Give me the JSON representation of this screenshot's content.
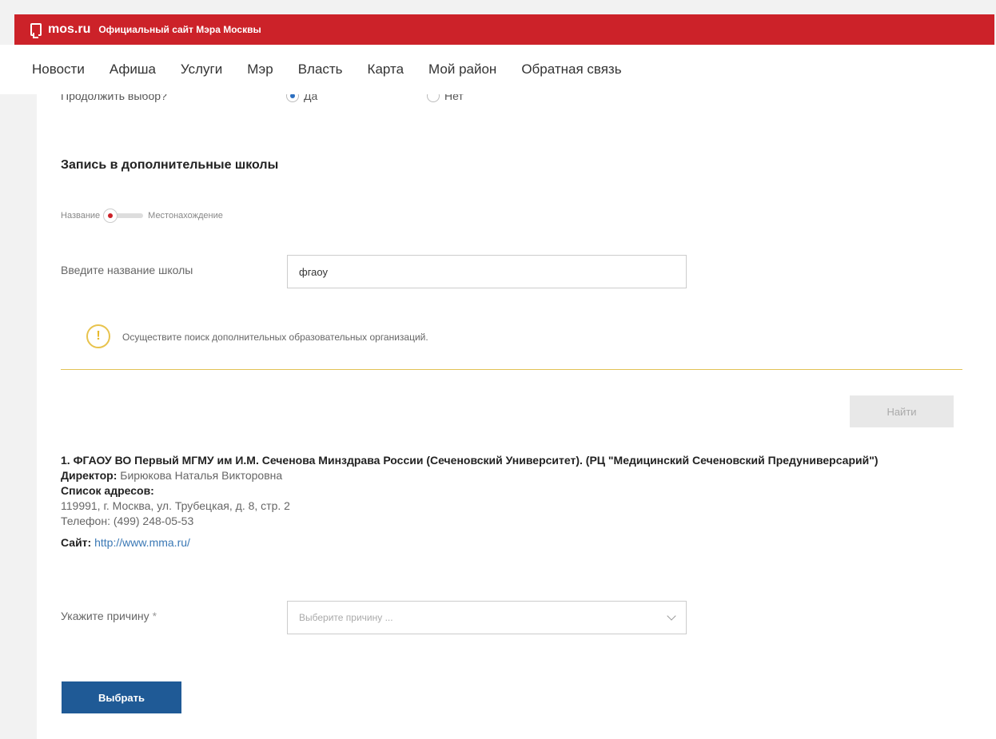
{
  "header": {
    "logo_text": "mos.ru",
    "slogan": "Официальный сайт Мэра Москвы"
  },
  "nav": {
    "items": [
      "Новости",
      "Афиша",
      "Услуги",
      "Мэр",
      "Власть",
      "Карта",
      "Мой район",
      "Обратная связь"
    ]
  },
  "continue_choice": {
    "question": "Продолжить выбор?",
    "yes": "Да",
    "no": "Нет",
    "selected": "Да"
  },
  "section": {
    "title": "Запись в дополнительные школы"
  },
  "search_mode": {
    "option_left": "Название",
    "option_right": "Местонахождение",
    "selected": "Название"
  },
  "school_search": {
    "label": "Введите название школы",
    "value": "фгаоу"
  },
  "notice": {
    "text": "Осуществите поиск дополнительных образовательных организаций."
  },
  "find_button": {
    "label": "Найти"
  },
  "result": {
    "name": "1. ФГАОУ ВО Первый МГМУ им И.М. Сеченова Минздрава России (Сеченовский Университет). (РЦ \"Медицинский Сеченовский Предуниверсарий\")",
    "director_label": "Директор:",
    "director": "Бирюкова Наталья Викторовна",
    "addresses_label": "Список адресов:",
    "address": "119991, г. Москва, ул. Трубецкая, д. 8, стр. 2",
    "phone": "Телефон: (499) 248-05-53",
    "site_label": "Сайт:",
    "site": "http://www.mma.ru/"
  },
  "reason": {
    "label": "Укажите причину",
    "required_mark": "*",
    "placeholder": "Выберите причину ..."
  },
  "submit_button": {
    "label": "Выбрать"
  }
}
